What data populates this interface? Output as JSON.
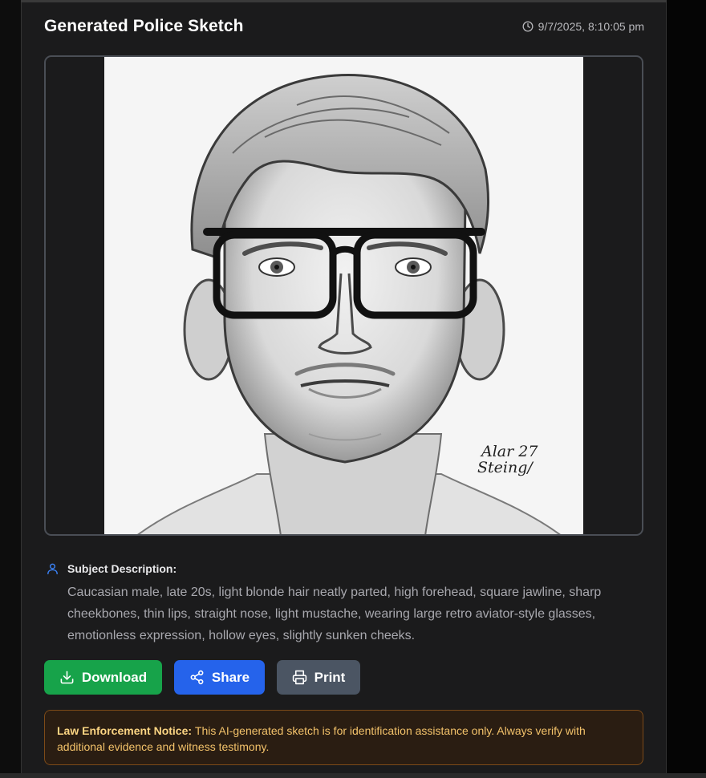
{
  "header": {
    "title": "Generated Police Sketch",
    "timestamp": "9/7/2025, 8:10:05 pm",
    "timestamp_icon": "clock-icon"
  },
  "image": {
    "signature_line1": "Alar 27",
    "signature_line2": "Steing/"
  },
  "description": {
    "icon": "user-icon",
    "label": "Subject Description:",
    "text": "Caucasian male, late 20s, light blonde hair neatly parted, high forehead, square jawline, sharp cheekbones, thin lips, straight nose, light mustache, wearing large retro aviator-style glasses, emotionless expression, hollow eyes, slightly sunken cheeks."
  },
  "actions": {
    "download": {
      "label": "Download",
      "icon": "download-icon",
      "color": "#17a34a"
    },
    "share": {
      "label": "Share",
      "icon": "share-icon",
      "color": "#2563eb"
    },
    "print": {
      "label": "Print",
      "icon": "printer-icon",
      "color": "#4b5563"
    }
  },
  "notice": {
    "title": "Law Enforcement Notice:",
    "text": "This AI-generated sketch is for identification assistance only. Always verify with additional evidence and witness testimony."
  }
}
